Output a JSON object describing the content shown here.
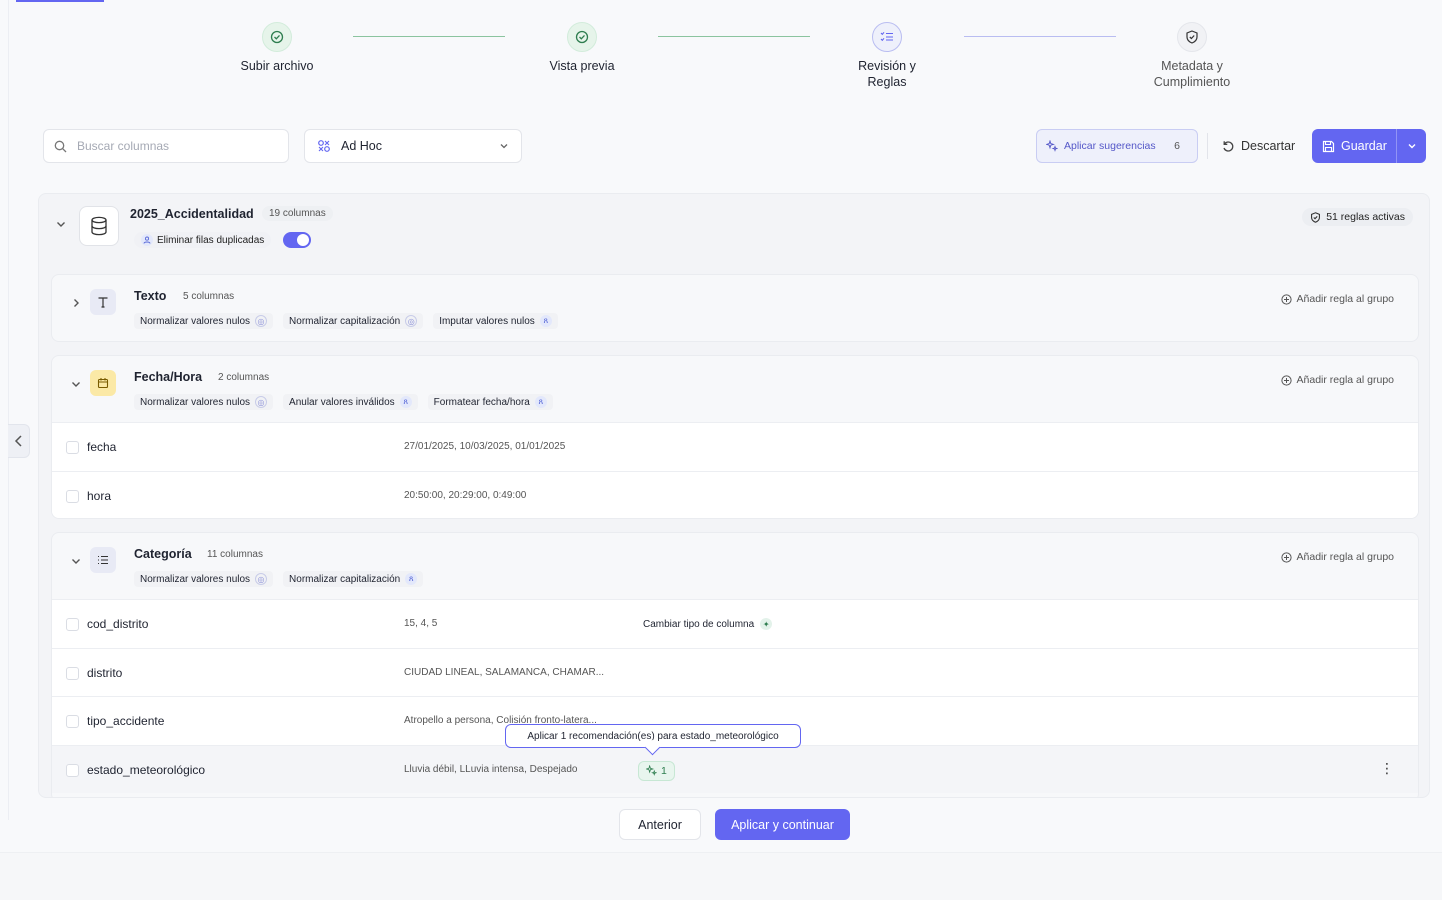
{
  "stepper": {
    "steps": [
      {
        "label": "Subir archivo",
        "state": "done"
      },
      {
        "label": "Vista previa",
        "state": "done"
      },
      {
        "label": "Revisión y Reglas",
        "state": "active"
      },
      {
        "label": "Metadata y Cumplimiento",
        "state": "todo"
      }
    ]
  },
  "toolbar": {
    "search_placeholder": "Buscar columnas",
    "mode_value": "Ad Hoc",
    "apply_suggestions_label": "Aplicar sugerencias",
    "apply_suggestions_count": "6",
    "discard_label": "Descartar",
    "save_label": "Guardar"
  },
  "dataset": {
    "name": "2025_Accidentalidad",
    "columns_count": "19 columnas",
    "dedupe_label": "Eliminar filas duplicadas",
    "dedupe_enabled": true,
    "active_rules": "51 reglas activas"
  },
  "groups": [
    {
      "title": "Texto",
      "count": "5 columnas",
      "add_rule": "Añadir regla al grupo",
      "chips": [
        "Normalizar valores nulos",
        "Normalizar capitalización",
        "Imputar valores nulos"
      ]
    },
    {
      "title": "Fecha/Hora",
      "count": "2 columnas",
      "add_rule": "Añadir regla al grupo",
      "chips": [
        "Normalizar valores nulos",
        "Anular valores inválidos",
        "Formatear fecha/hora"
      ],
      "rows": [
        {
          "name": "fecha",
          "sample": "27/01/2025, 10/03/2025, 01/01/2025"
        },
        {
          "name": "hora",
          "sample": "20:50:00, 20:29:00, 0:49:00"
        }
      ]
    },
    {
      "title": "Categoría",
      "count": "11 columnas",
      "add_rule": "Añadir regla al grupo",
      "chips": [
        "Normalizar valores nulos",
        "Normalizar capitalización"
      ],
      "rows": [
        {
          "name": "cod_distrito",
          "sample": "15, 4, 5",
          "action": "Cambiar tipo de columna"
        },
        {
          "name": "distrito",
          "sample": "CIUDAD LINEAL, SALAMANCA, CHAMAR..."
        },
        {
          "name": "tipo_accidente",
          "sample": "Atropello a persona, Colisión fronto-latera..."
        },
        {
          "name": "estado_meteorológico",
          "sample": "Lluvia débil, LLuvia intensa, Despejado",
          "recommendations": "1"
        }
      ]
    }
  ],
  "tooltip": "Aplicar 1 recomendación(es) para estado_meteorológico",
  "footer": {
    "prev_label": "Anterior",
    "next_label": "Aplicar y continuar"
  },
  "colors": {
    "accent": "#6366f1",
    "done": "#2e7d4f"
  }
}
